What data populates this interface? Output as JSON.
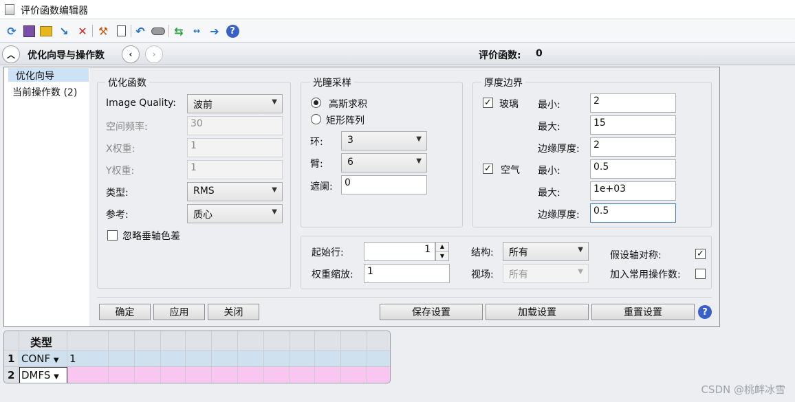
{
  "window": {
    "title": "评价函数编辑器"
  },
  "toolbar": {
    "icons": [
      "refresh-icon",
      "save-icon",
      "load-icon",
      "insert-icon",
      "delete-icon",
      "wizard-icon",
      "file-icon",
      "undo-icon",
      "toggle-icon",
      "swap-icon",
      "arrow-dotted-icon",
      "arrow-right-icon",
      "help-icon"
    ]
  },
  "wizardbar": {
    "title": "优化向导与操作数",
    "mf_label": "评价函数:",
    "mf_value": "0"
  },
  "nav": {
    "items": [
      "优化向导",
      "当前操作数 (2)"
    ]
  },
  "opt_func": {
    "title": "优化函数",
    "image_quality_label": "Image Quality:",
    "image_quality_value": "波前",
    "spatial_freq_label": "空间频率:",
    "spatial_freq_value": "30",
    "x_weight_label": "X权重:",
    "x_weight_value": "1",
    "y_weight_label": "Y权重:",
    "y_weight_value": "1",
    "type_label": "类型:",
    "type_value": "RMS",
    "ref_label": "参考:",
    "ref_value": "质心",
    "ignore_label": "忽略垂轴色差"
  },
  "pupil": {
    "title": "光瞳采样",
    "gauss_label": "高斯求积",
    "rect_label": "矩形阵列",
    "rings_label": "环:",
    "rings_value": "3",
    "arms_label": "臂:",
    "arms_value": "6",
    "obscuration_label": "遮阑:",
    "obscuration_value": "0"
  },
  "thickness": {
    "title": "厚度边界",
    "glass_label": "玻璃",
    "air_label": "空气",
    "min_label": "最小:",
    "max_label": "最大:",
    "edge_label": "边缘厚度:",
    "glass_min": "2",
    "glass_max": "15",
    "glass_edge": "2",
    "air_min": "0.5",
    "air_max": "1e+03",
    "air_edge": "0.5"
  },
  "bottom": {
    "start_row_label": "起始行:",
    "start_row_value": "1",
    "weight_scale_label": "权重缩放:",
    "weight_scale_value": "1",
    "config_label": "结构:",
    "config_value": "所有",
    "field_label": "视场:",
    "field_value": "所有",
    "symmetric_label": "假设轴对称:",
    "add_common_label": "加入常用操作数:"
  },
  "buttons": {
    "ok": "确定",
    "apply": "应用",
    "close": "关闭",
    "save": "保存设置",
    "load": "加载设置",
    "reset": "重置设置"
  },
  "grid": {
    "header": "类型",
    "rows": [
      {
        "num": "1",
        "type": "CONF",
        "value": "1"
      },
      {
        "num": "2",
        "type": "DMFS",
        "value": ""
      }
    ]
  },
  "watermark": "CSDN @桃衅冰雪"
}
